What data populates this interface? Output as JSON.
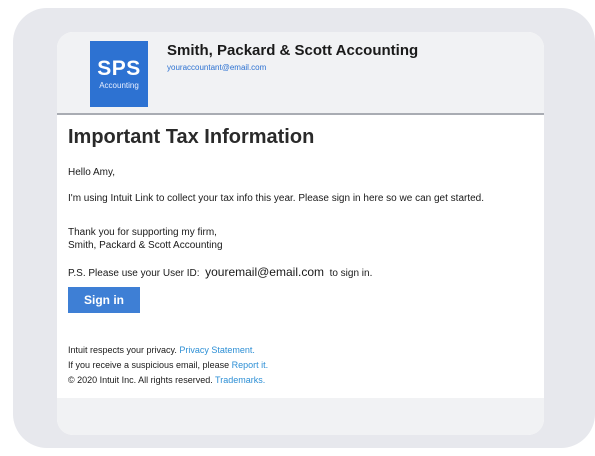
{
  "header": {
    "logo_main": "SPS",
    "logo_sub": "Accounting",
    "firm_name": "Smith, Packard & Scott Accounting",
    "firm_email": "youraccountant@email.com"
  },
  "body": {
    "heading": "Important Tax Information",
    "greeting": "Hello Amy,",
    "intro": "I'm using Intuit Link to collect your tax info this year. Please sign in here so we can get started.",
    "thanks": "Thank you for supporting my firm,",
    "signature": "Smith, Packard & Scott Accounting",
    "ps_prefix": "P.S. Please use your User ID:",
    "ps_user_id": "youremail@email.com",
    "ps_suffix": "to sign in.",
    "signin_label": "Sign in"
  },
  "footer": {
    "privacy_text": "Intuit respects your privacy.",
    "privacy_link": "Privacy Statement.",
    "report_text": "If you receive a suspicious email, please",
    "report_link": "Report it.",
    "copyright_text": "© 2020 Intuit Inc. All rights reserved.",
    "trademarks_link": "Trademarks."
  },
  "colors": {
    "brand_blue": "#2d72d2",
    "button_blue": "#3e7fd5",
    "link_blue": "#2d8fd5",
    "frame_gray": "#e7e8ed",
    "header_gray": "#f1f2f4"
  }
}
